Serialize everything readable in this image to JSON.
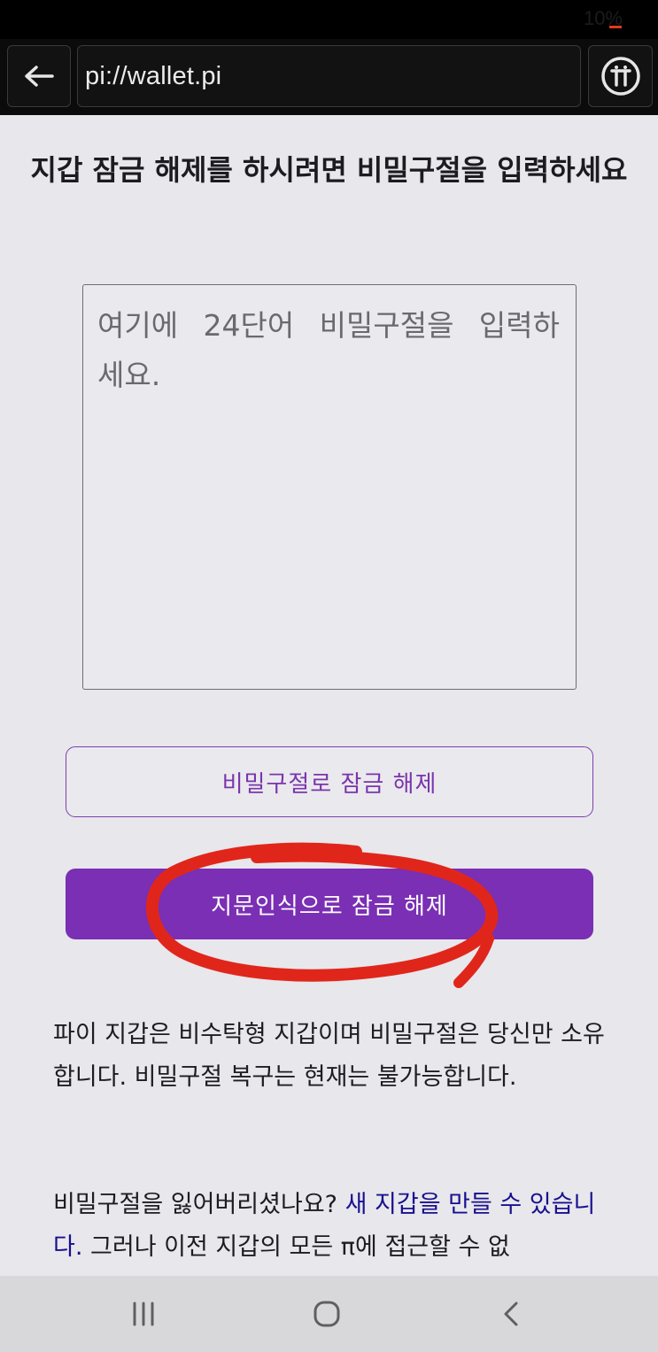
{
  "status_bar": {
    "battery_text": "10%"
  },
  "browser": {
    "back_icon": "arrow-left-icon",
    "url": "pi://wallet.pi",
    "pi_icon": "pi-coin-icon"
  },
  "unlock": {
    "title": "지갑 잠금 해제를 하시려면 비밀구절을 입력하세요",
    "passphrase_placeholder": "여기에 24단어 비밀구절을 입력하세요.",
    "passphrase_value": "",
    "unlock_with_passphrase_label": "비밀구절로 잠금 해제",
    "unlock_with_fingerprint_label": "지문인식으로 잠금 해제"
  },
  "info": {
    "custody_text": "파이 지갑은 비수탁형 지갑이며 비밀구절은 당신만 소유합니다. 비밀구절 복구는 현재는 불가능합니다.",
    "lost_question": "비밀구절을 잃어버리셨나요?",
    "create_wallet_link": "새 지갑을 만들 수 있습니다.",
    "warning_text": "그러나 이전 지갑의 모든 π에 접근할 수 없"
  },
  "nav_bar": {
    "recents_icon": "recents-icon",
    "home_icon": "home-icon",
    "back_icon": "chevron-left-icon"
  },
  "colors": {
    "accent": "#7a2fb4",
    "link": "#18108f",
    "annotation": "#e0261b"
  }
}
